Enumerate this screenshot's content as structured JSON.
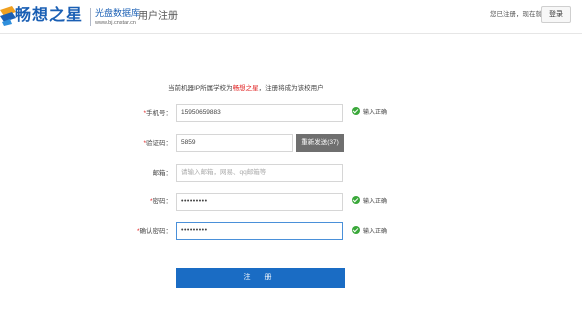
{
  "header": {
    "logo_text": "畅想之星",
    "logo_sub": "光盘数据库",
    "logo_url": "www.bj.cnstar.cn",
    "page_title": "用户注册",
    "login_hint": "您已注册，现在就",
    "login_button": "登录"
  },
  "notice": {
    "prefix": "当前机器IP所属学校为",
    "brand": "畅想之星",
    "suffix": "，注册将成为该校用户"
  },
  "form": {
    "phone": {
      "required_mark": "*",
      "label": "手机号：",
      "value": "15950659883"
    },
    "code": {
      "required_mark": "*",
      "label": "验证码：",
      "value": "5859",
      "resend_label": "重新发送(37)"
    },
    "email": {
      "label": "邮箱：",
      "placeholder": "请输入邮箱，网易、qq邮箱等"
    },
    "password": {
      "required_mark": "*",
      "label": "密码：",
      "value": "•••••••••"
    },
    "confirm": {
      "required_mark": "*",
      "label": "确认密码：",
      "value": "•••••••••"
    },
    "status_ok": "输入正确",
    "submit_label": "注 册"
  },
  "colors": {
    "brand_blue": "#1a5fb4",
    "button_blue": "#1a6cc4",
    "resend_gray": "#6f6f6f",
    "required_red": "#e02020",
    "ok_green": "#3aa83a"
  }
}
